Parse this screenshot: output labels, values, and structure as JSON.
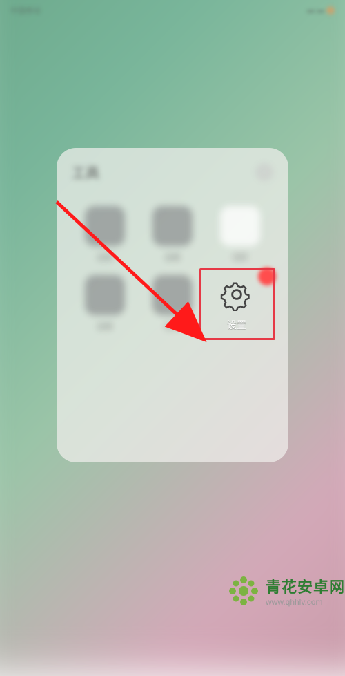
{
  "status": {
    "left": "中国移动",
    "center": "",
    "right": "⋯"
  },
  "folder": {
    "title": "工具"
  },
  "apps": {
    "row1": [
      {
        "label": "应用"
      },
      {
        "label": "应用"
      },
      {
        "label": "日历"
      }
    ],
    "row2": [
      {
        "label": "应用"
      },
      {
        "label": "应用"
      }
    ],
    "settings": {
      "label": "设置"
    }
  },
  "annotation": {
    "highlight_color": "#e63946",
    "arrow_color": "#ff1a1a"
  },
  "watermark": {
    "brand": "青花安卓网",
    "url": "www.qhhlv.com",
    "brand_color": "#2e7d32"
  }
}
